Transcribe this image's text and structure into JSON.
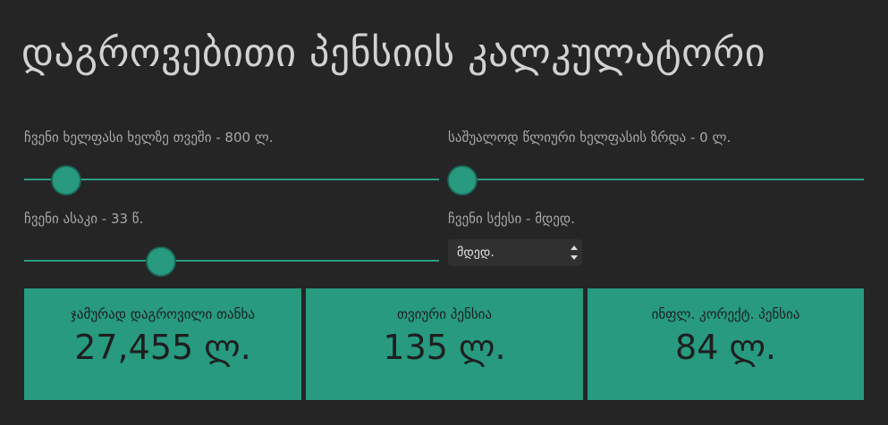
{
  "title": "დაგროვებითი პენსიის კალკულატორი",
  "salary": {
    "label": "ჩვენი ხელფასი ხელზე თვეში - 800 ლ.",
    "value": 800
  },
  "growth": {
    "label": "საშუალოდ წლიური ხელფასის ზრდა - 0 ლ.",
    "value": 0
  },
  "age": {
    "label": "ჩვენი ასაკი - 33 წ.",
    "value": 33
  },
  "gender": {
    "label": "ჩვენი სქესი - მდედ.",
    "selected": "მდედ."
  },
  "results": [
    {
      "label": "ჯამურად დაგროვილი თანხა",
      "value": "27,455 ლ."
    },
    {
      "label": "თვიური პენსია",
      "value": "135 ლ."
    },
    {
      "label": "ინფლ. კორექტ. პენსია",
      "value": "84 ლ."
    }
  ],
  "colors": {
    "background": "#252525",
    "accent": "#279a80",
    "text": "#cfcfcf"
  }
}
